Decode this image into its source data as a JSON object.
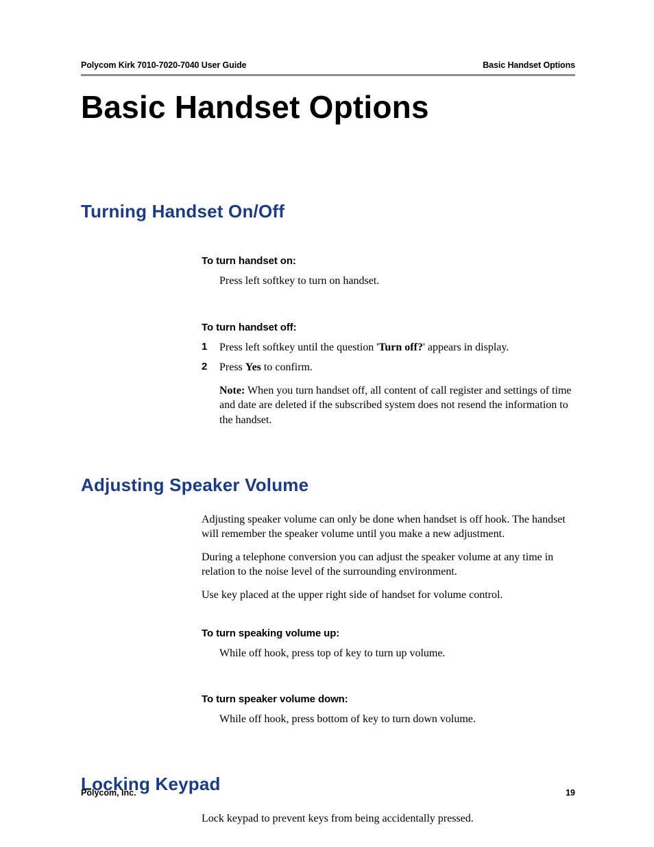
{
  "header": {
    "left": "Polycom Kirk 7010-7020-7040 User Guide",
    "right": "Basic Handset Options"
  },
  "title": "Basic Handset Options",
  "sections": {
    "turning": {
      "heading": "Turning Handset On/Off",
      "on": {
        "subhead": "To turn handset on:",
        "body": "Press left softkey to turn on handset."
      },
      "off": {
        "subhead": "To turn handset off:",
        "step1_pre": "Press left softkey until the question '",
        "step1_bold": "Turn off?",
        "step1_post": "' appears in display.",
        "step2_pre": "Press ",
        "step2_bold": "Yes",
        "step2_post": " to confirm.",
        "note_label": "Note:",
        "note_body": " When you turn handset off, all content of call register and settings of time and date are deleted if the subscribed system does not resend the information to the handset."
      }
    },
    "volume": {
      "heading": "Adjusting Speaker Volume",
      "p1": "Adjusting speaker volume can only be done when handset is off hook. The handset will remember the speaker volume until you make a new adjustment.",
      "p2": "During a telephone conversion you can adjust the speaker volume at any time in relation to the noise level of the surrounding environment.",
      "p3": "Use key placed at the upper right side of handset for volume control.",
      "up": {
        "subhead": "To turn speaking volume up:",
        "body": "While off hook, press top of key to turn up volume."
      },
      "down": {
        "subhead": "To turn speaker volume down:",
        "body": "While off hook, press bottom of key to turn down volume."
      }
    },
    "locking": {
      "heading": "Locking Keypad",
      "p1": "Lock keypad to prevent keys from being accidentally pressed."
    }
  },
  "footer": {
    "left": "Polycom, Inc.",
    "right": "19"
  }
}
